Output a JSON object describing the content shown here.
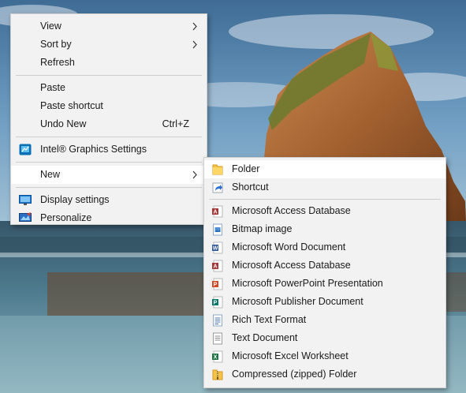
{
  "context_menu": {
    "items": [
      {
        "label": "View",
        "has_submenu": true
      },
      {
        "label": "Sort by",
        "has_submenu": true
      },
      {
        "label": "Refresh"
      },
      {
        "label": "Paste"
      },
      {
        "label": "Paste shortcut"
      },
      {
        "label": "Undo New",
        "shortcut": "Ctrl+Z"
      },
      {
        "label": "Intel® Graphics Settings",
        "icon": "intel-graphics-icon"
      },
      {
        "label": "New",
        "has_submenu": true,
        "highlighted": true
      },
      {
        "label": "Display settings",
        "icon": "display-settings-icon"
      },
      {
        "label": "Personalize",
        "icon": "personalize-icon"
      }
    ]
  },
  "new_submenu": {
    "items": [
      {
        "label": "Folder",
        "icon": "folder-icon",
        "highlighted": true
      },
      {
        "label": "Shortcut",
        "icon": "shortcut-icon"
      },
      {
        "label": "Microsoft Access Database",
        "icon": "access-icon"
      },
      {
        "label": "Bitmap image",
        "icon": "bitmap-icon"
      },
      {
        "label": "Microsoft Word Document",
        "icon": "word-icon"
      },
      {
        "label": "Microsoft Access Database",
        "icon": "access-icon"
      },
      {
        "label": "Microsoft PowerPoint Presentation",
        "icon": "powerpoint-icon"
      },
      {
        "label": "Microsoft Publisher Document",
        "icon": "publisher-icon"
      },
      {
        "label": "Rich Text Format",
        "icon": "rich-text-icon"
      },
      {
        "label": "Text Document",
        "icon": "text-document-icon"
      },
      {
        "label": "Microsoft Excel Worksheet",
        "icon": "excel-icon"
      },
      {
        "label": "Compressed (zipped) Folder",
        "icon": "zip-folder-icon"
      }
    ]
  },
  "colors": {
    "menu_bg": "#f2f2f2",
    "highlight": "#ffffff",
    "separator": "#cdcdcd",
    "access": "#a4373a",
    "word": "#2b579a",
    "powerpoint": "#d24726",
    "publisher": "#077568",
    "excel": "#217346"
  }
}
